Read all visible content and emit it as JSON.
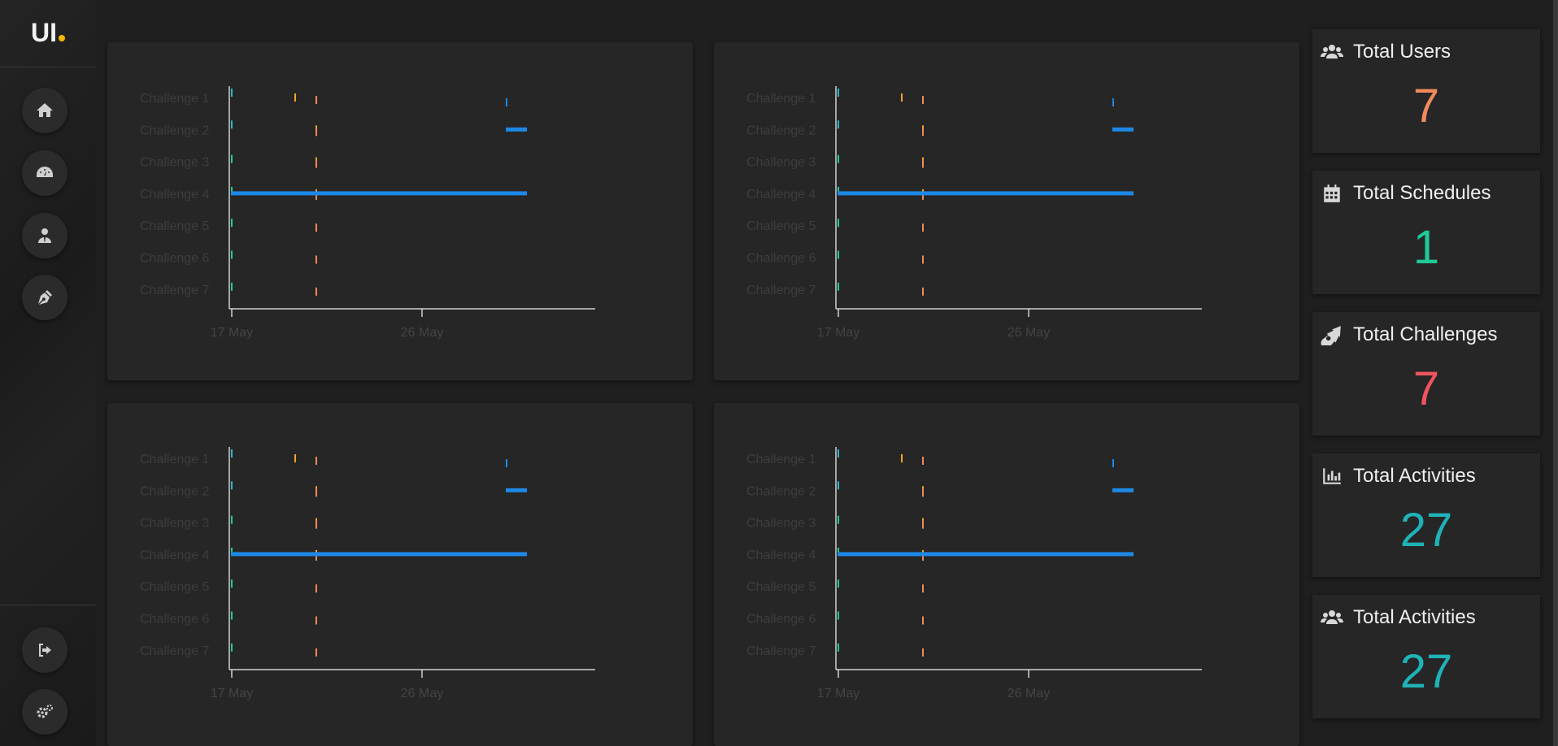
{
  "sidebar": {
    "logo_text": "UI",
    "logo_dot_color": "#f5b800",
    "nav": [
      {
        "icon": "home-icon"
      },
      {
        "icon": "dashboard-icon"
      },
      {
        "icon": "user-tie-icon"
      },
      {
        "icon": "pen-nib-icon"
      }
    ],
    "bottom": [
      {
        "icon": "sign-out-icon"
      },
      {
        "icon": "cogs-icon"
      }
    ]
  },
  "charts": [
    {
      "id": "chart-1"
    },
    {
      "id": "chart-2"
    },
    {
      "id": "chart-3"
    },
    {
      "id": "chart-4"
    }
  ],
  "chart_data": {
    "type": "timeline",
    "categories": [
      "Challenge 1",
      "Challenge 2",
      "Challenge 3",
      "Challenge 4",
      "Challenge 5",
      "Challenge 6",
      "Challenge 7"
    ],
    "x_ticks": [
      "17 May",
      "26 May"
    ],
    "grid": false,
    "series": [
      {
        "color": "#2ab7c8",
        "bars": [
          {
            "row": "Challenge 1",
            "start": "17 May",
            "end": "17 May"
          },
          {
            "row": "Challenge 2",
            "start": "17 May",
            "end": "17 May"
          }
        ]
      },
      {
        "color": "#20c997",
        "bars": [
          {
            "row": "Challenge 3",
            "start": "17 May",
            "end": "17 May"
          },
          {
            "row": "Challenge 4",
            "start": "17 May",
            "end": "17 May"
          },
          {
            "row": "Challenge 5",
            "start": "17 May",
            "end": "17 May"
          },
          {
            "row": "Challenge 6",
            "start": "17 May",
            "end": "17 May"
          },
          {
            "row": "Challenge 7",
            "start": "17 May",
            "end": "17 May"
          }
        ]
      },
      {
        "color": "#f5a623",
        "bars": [
          {
            "row": "Challenge 1",
            "start": "20 May",
            "end": "20 May"
          },
          {
            "row": "Challenge 2",
            "start": "21 May",
            "end": "21 May"
          },
          {
            "row": "Challenge 3",
            "start": "21 May",
            "end": "21 May"
          },
          {
            "row": "Challenge 4",
            "start": "21 May",
            "end": "21 May"
          }
        ]
      },
      {
        "color": "#f08a5d",
        "bars": [
          {
            "row": "Challenge 1",
            "start": "21 May",
            "end": "21 May"
          },
          {
            "row": "Challenge 2",
            "start": "21 May",
            "end": "21 May"
          },
          {
            "row": "Challenge 3",
            "start": "21 May",
            "end": "21 May"
          },
          {
            "row": "Challenge 4",
            "start": "21 May",
            "end": "21 May"
          },
          {
            "row": "Challenge 5",
            "start": "21 May",
            "end": "21 May"
          },
          {
            "row": "Challenge 6",
            "start": "21 May",
            "end": "21 May"
          },
          {
            "row": "Challenge 7",
            "start": "21 May",
            "end": "21 May"
          }
        ]
      },
      {
        "color": "#1e88e5",
        "bars": [
          {
            "row": "Challenge 1",
            "start": "30 May",
            "end": "30 May"
          },
          {
            "row": "Challenge 2",
            "start": "30 May",
            "end": "31 May"
          },
          {
            "row": "Challenge 4",
            "start": "17 May",
            "end": "31 May"
          }
        ]
      }
    ]
  },
  "stats": [
    {
      "icon": "users-icon",
      "title": "Total Users",
      "value": "7",
      "color": "#f08a5d"
    },
    {
      "icon": "calendar-icon",
      "title": "Total Schedules",
      "value": "1",
      "color": "#20c997"
    },
    {
      "icon": "meteor-icon",
      "title": "Total Challenges",
      "value": "7",
      "color": "#f1545f"
    },
    {
      "icon": "bar-chart-icon",
      "title": "Total Activities",
      "value": "27",
      "color": "#1eb3b8"
    },
    {
      "icon": "users-icon",
      "title": "Total Activities",
      "value": "27",
      "color": "#1eb3b8"
    }
  ]
}
